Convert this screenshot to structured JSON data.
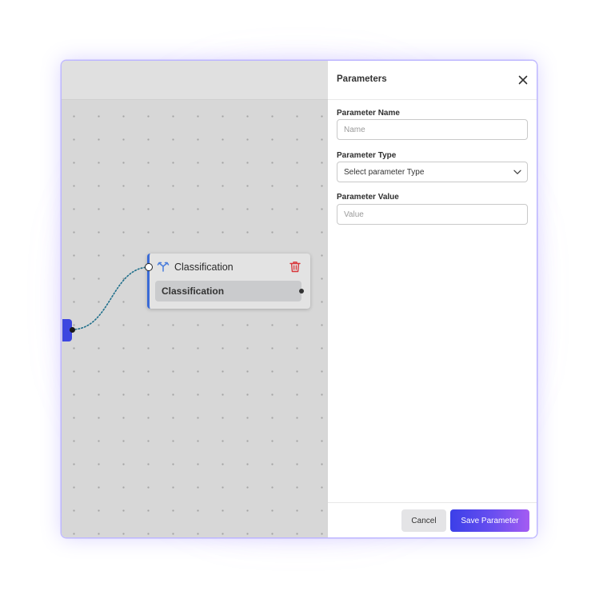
{
  "canvas": {
    "node": {
      "title": "Classification",
      "body_label": "Classification",
      "icon": "split-arrows-icon",
      "delete_icon": "trash-icon"
    }
  },
  "panel": {
    "title": "Parameters",
    "close_icon": "close-icon",
    "fields": {
      "name": {
        "label": "Parameter Name",
        "placeholder": "Name",
        "value": ""
      },
      "type": {
        "label": "Parameter Type",
        "selected": "Select parameter Type"
      },
      "value": {
        "label": "Parameter Value",
        "placeholder": "Value",
        "value": ""
      }
    },
    "footer": {
      "cancel_label": "Cancel",
      "save_label": "Save Parameter"
    }
  },
  "colors": {
    "accent_start": "#3b3fe8",
    "accent_end": "#a45cf2",
    "node_border": "#3b6bd6",
    "delete": "#d9373b",
    "edge": "#1f6f8b"
  }
}
